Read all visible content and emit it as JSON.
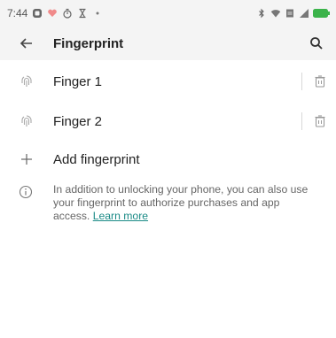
{
  "status_bar": {
    "time": "7:44",
    "left_icons": [
      "notification-icon",
      "heart-icon",
      "timer-icon",
      "hourglass-icon",
      "dot-icon"
    ],
    "right_icons": [
      "bluetooth-icon",
      "wifi-icon",
      "sim-icon",
      "signal-icon",
      "battery-icon"
    ]
  },
  "app_bar": {
    "title": "Fingerprint"
  },
  "fingerprints": [
    {
      "label": "Finger 1"
    },
    {
      "label": "Finger 2"
    }
  ],
  "add_fingerprint": {
    "label": "Add fingerprint"
  },
  "info": {
    "text": "In addition to unlocking your phone, you can also use your fingerprint to authorize purchases and app access.",
    "link": "Learn more"
  },
  "colors": {
    "link": "#1a8a86",
    "bar_background": "#f4f4f4",
    "battery": "#3bb34a"
  }
}
